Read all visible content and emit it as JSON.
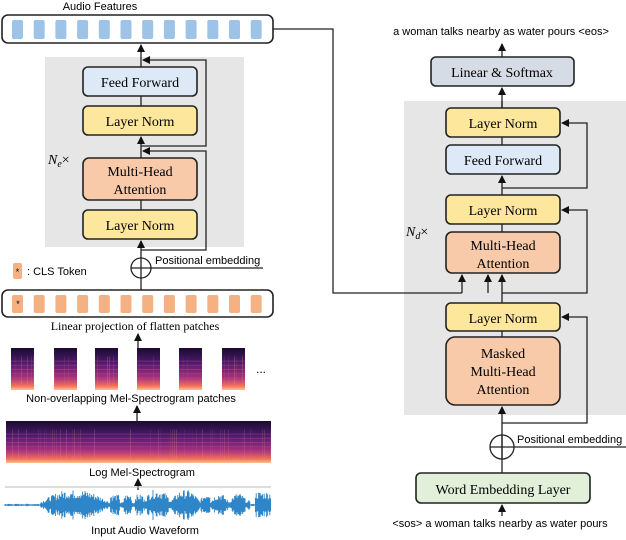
{
  "encoder": {
    "audio_features_label": "Audio Features",
    "feed_forward": "Feed Forward",
    "layer_norm_top": "Layer Norm",
    "mha_line1": "Multi-Head",
    "mha_line2": "Attention",
    "layer_norm_bottom": "Layer Norm",
    "repeat_label": "N",
    "repeat_sub": "e",
    "repeat_times": "×",
    "positional_embedding": "Positional embedding",
    "cls_token_marker": "*",
    "cls_token_legend": ": CLS Token",
    "linear_projection": "Linear projection of flatten patches",
    "patches_label": "Non-overlapping Mel-Spectrogram patches",
    "ellipsis": "...",
    "spectrogram_label": "Log Mel-Spectrogram",
    "waveform_label": "Input Audio Waveform"
  },
  "decoder": {
    "output_text": "a woman talks nearby as water pours <eos>",
    "linear_softmax": "Linear & Softmax",
    "layer_norm_3": "Layer Norm",
    "feed_forward": "Feed Forward",
    "layer_norm_2": "Layer Norm",
    "mha_line1": "Multi-Head",
    "mha_line2": "Attention",
    "layer_norm_1": "Layer Norm",
    "masked_line1": "Masked",
    "masked_line2": "Multi-Head",
    "masked_line3": "Attention",
    "repeat_label": "N",
    "repeat_sub": "d",
    "repeat_times": "×",
    "positional_embedding": "Positional embedding",
    "word_embedding": "Word Embedding Layer",
    "input_text": "<sos> a woman talks nearby as water pours"
  },
  "colors": {
    "feed_forward": "#dde9f6",
    "layer_norm": "#fde79c",
    "attention": "#f8caa9",
    "linear_softmax": "#d6dce5",
    "word_embedding": "#e2f0d9",
    "block_bg": "#e6e6e6",
    "feature_token": "#9dc3e6",
    "patch_token": "#f4b183",
    "waveform": "#2e86c8"
  }
}
